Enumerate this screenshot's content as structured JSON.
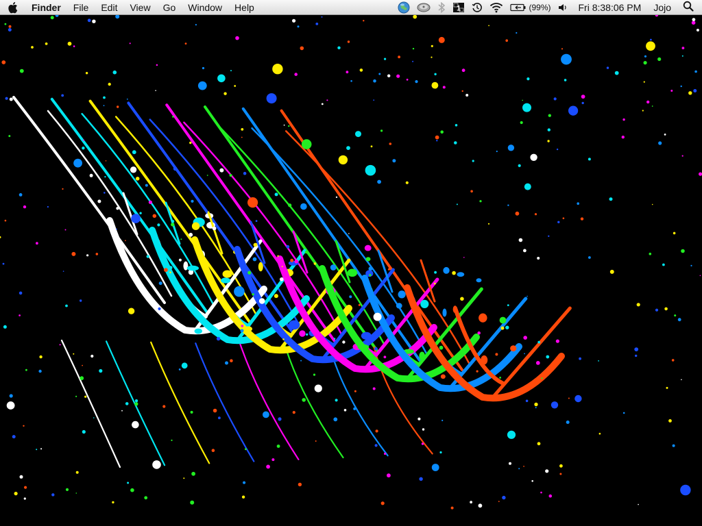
{
  "menubar": {
    "apple_menu": "apple-icon",
    "app_name": "Finder",
    "items": [
      "File",
      "Edit",
      "View",
      "Go",
      "Window",
      "Help"
    ],
    "status_icons": [
      "globe-icon",
      "time-machine-disk-icon",
      "bluetooth-icon",
      "spaces-icon",
      "time-machine-icon",
      "wifi-icon",
      "battery-icon",
      "volume-icon"
    ],
    "spaces_number": "1",
    "battery_percent": "(99%)",
    "clock": "Fri 8:38:06 PM",
    "user": "Jojo",
    "spotlight": "spotlight-icon"
  },
  "desktop": {
    "wallpaper": "paint-splatter-wallpaper",
    "background": "#000000",
    "paint_colors": [
      "#ffffff",
      "#00e5f0",
      "#ffee00",
      "#1a4dff",
      "#ff00ee",
      "#22ee22",
      "#0a8cff",
      "#ff4a0a"
    ]
  }
}
